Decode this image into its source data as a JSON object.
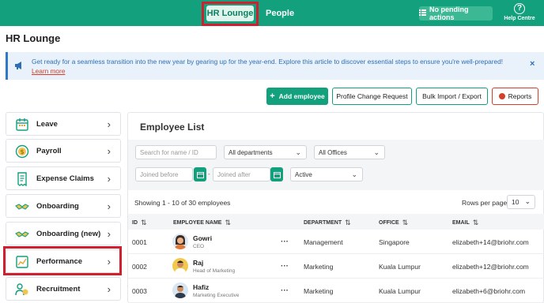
{
  "topbar": {
    "tab_hr_lounge": "HR Lounge",
    "tab_people": "People",
    "pending": "No pending actions",
    "help": "Help Centre"
  },
  "page_title": "HR Lounge",
  "banner": {
    "text": "Get ready for a seamless transition into the new year by gearing up for the year-end. Explore this article to discover essential steps to ensure you're well-prepared!",
    "link": "Learn more",
    "close": "×"
  },
  "actions": {
    "add_employee": "Add employee",
    "profile_change": "Profile Change Request",
    "bulk": "Bulk Import / Export",
    "reports": "Reports"
  },
  "sidebar": {
    "items": [
      {
        "label": "Leave",
        "icon": "calendar-icon"
      },
      {
        "label": "Payroll",
        "icon": "dollar-coin-icon"
      },
      {
        "label": "Expense Claims",
        "icon": "receipt-icon"
      },
      {
        "label": "Onboarding",
        "icon": "handshake-icon"
      },
      {
        "label": "Onboarding (new)",
        "icon": "handshake-icon"
      },
      {
        "label": "Performance",
        "icon": "performance-chart-icon"
      },
      {
        "label": "Recruitment",
        "icon": "recruitment-people-icon"
      }
    ]
  },
  "employee_list": {
    "title": "Employee List",
    "search_placeholder": "Search for name / ID",
    "department_filter": "All departments",
    "office_filter": "All Offices",
    "joined_before_placeholder": "Joined before",
    "joined_after_placeholder": "Joined after",
    "status_filter": "Active",
    "showing": "Showing 1 - 10 of 30 employees",
    "rows_per_page_label": "Rows per page",
    "rows_per_page": "10",
    "columns": [
      "ID",
      "EMPLOYEE NAME",
      "DEPARTMENT",
      "OFFICE",
      "EMAIL"
    ],
    "rows": [
      {
        "id": "0001",
        "name": "Gowri",
        "title": "CEO",
        "department": "Management",
        "office": "Singapore",
        "email": "elizabeth+14@briohr.com"
      },
      {
        "id": "0002",
        "name": "Raj",
        "title": "Head of Marketing",
        "department": "Marketing",
        "office": "Kuala Lumpur",
        "email": "elizabeth+12@briohr.com"
      },
      {
        "id": "0003",
        "name": "Hafiz",
        "title": "Marketing Executive",
        "department": "Marketing",
        "office": "Kuala Lumpur",
        "email": "elizabeth+6@briohr.com"
      }
    ]
  },
  "colors": {
    "brand": "#12a07d",
    "highlight": "#d0202f",
    "banner_bg": "#e9f2fb",
    "reports_accent": "#d0402a"
  }
}
